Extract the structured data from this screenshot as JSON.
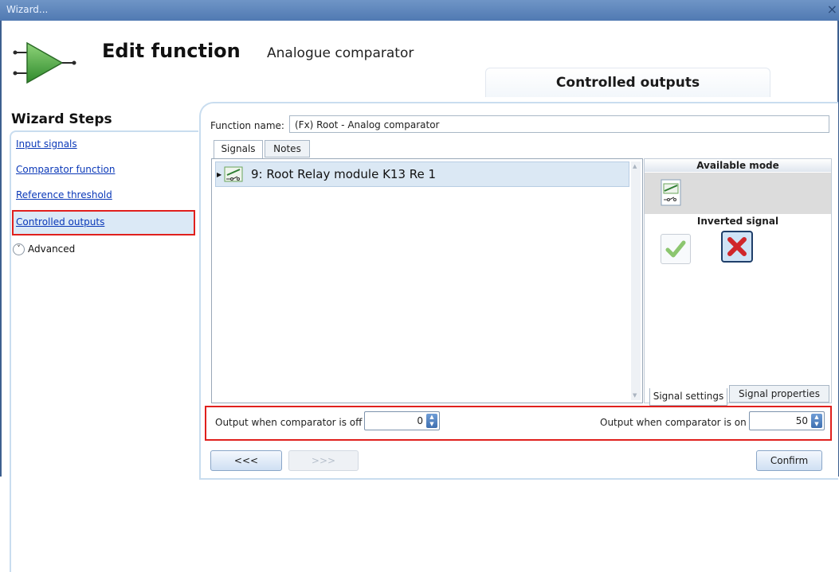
{
  "window": {
    "title": "Wizard...",
    "close": "×"
  },
  "header": {
    "title": "Edit function",
    "subtitle": "Analogue comparator",
    "current_step_tab": "Controlled outputs"
  },
  "wizard_steps": {
    "title": "Wizard Steps",
    "items": [
      {
        "label": "Input signals"
      },
      {
        "label": "Comparator function"
      },
      {
        "label": "Reference threshold"
      },
      {
        "label": "Controlled outputs",
        "selected": true
      }
    ],
    "advanced_label": "Advanced"
  },
  "function_name": {
    "label": "Function name:",
    "value": "(Fx) Root - Analog comparator"
  },
  "tabs": {
    "signals": "Signals",
    "notes": "Notes"
  },
  "signals_list": {
    "rows": [
      {
        "label": "9: Root Relay module K13 Re 1",
        "icon": "relay-icon"
      }
    ]
  },
  "side_panel": {
    "available_mode": "Available mode",
    "inverted_signal": "Inverted signal",
    "tab_settings": "Signal settings",
    "tab_properties": "Signal properties"
  },
  "outputs": {
    "off_label": "Output when comparator is off",
    "off_value": "0",
    "on_label": "Output when comparator is on",
    "on_value": "50"
  },
  "buttons": {
    "back": "<<<",
    "next": ">>>",
    "confirm": "Confirm"
  },
  "colors": {
    "accent": "#e0201d",
    "selection": "#dbe9f6",
    "titlebar": "#5b83ba"
  }
}
